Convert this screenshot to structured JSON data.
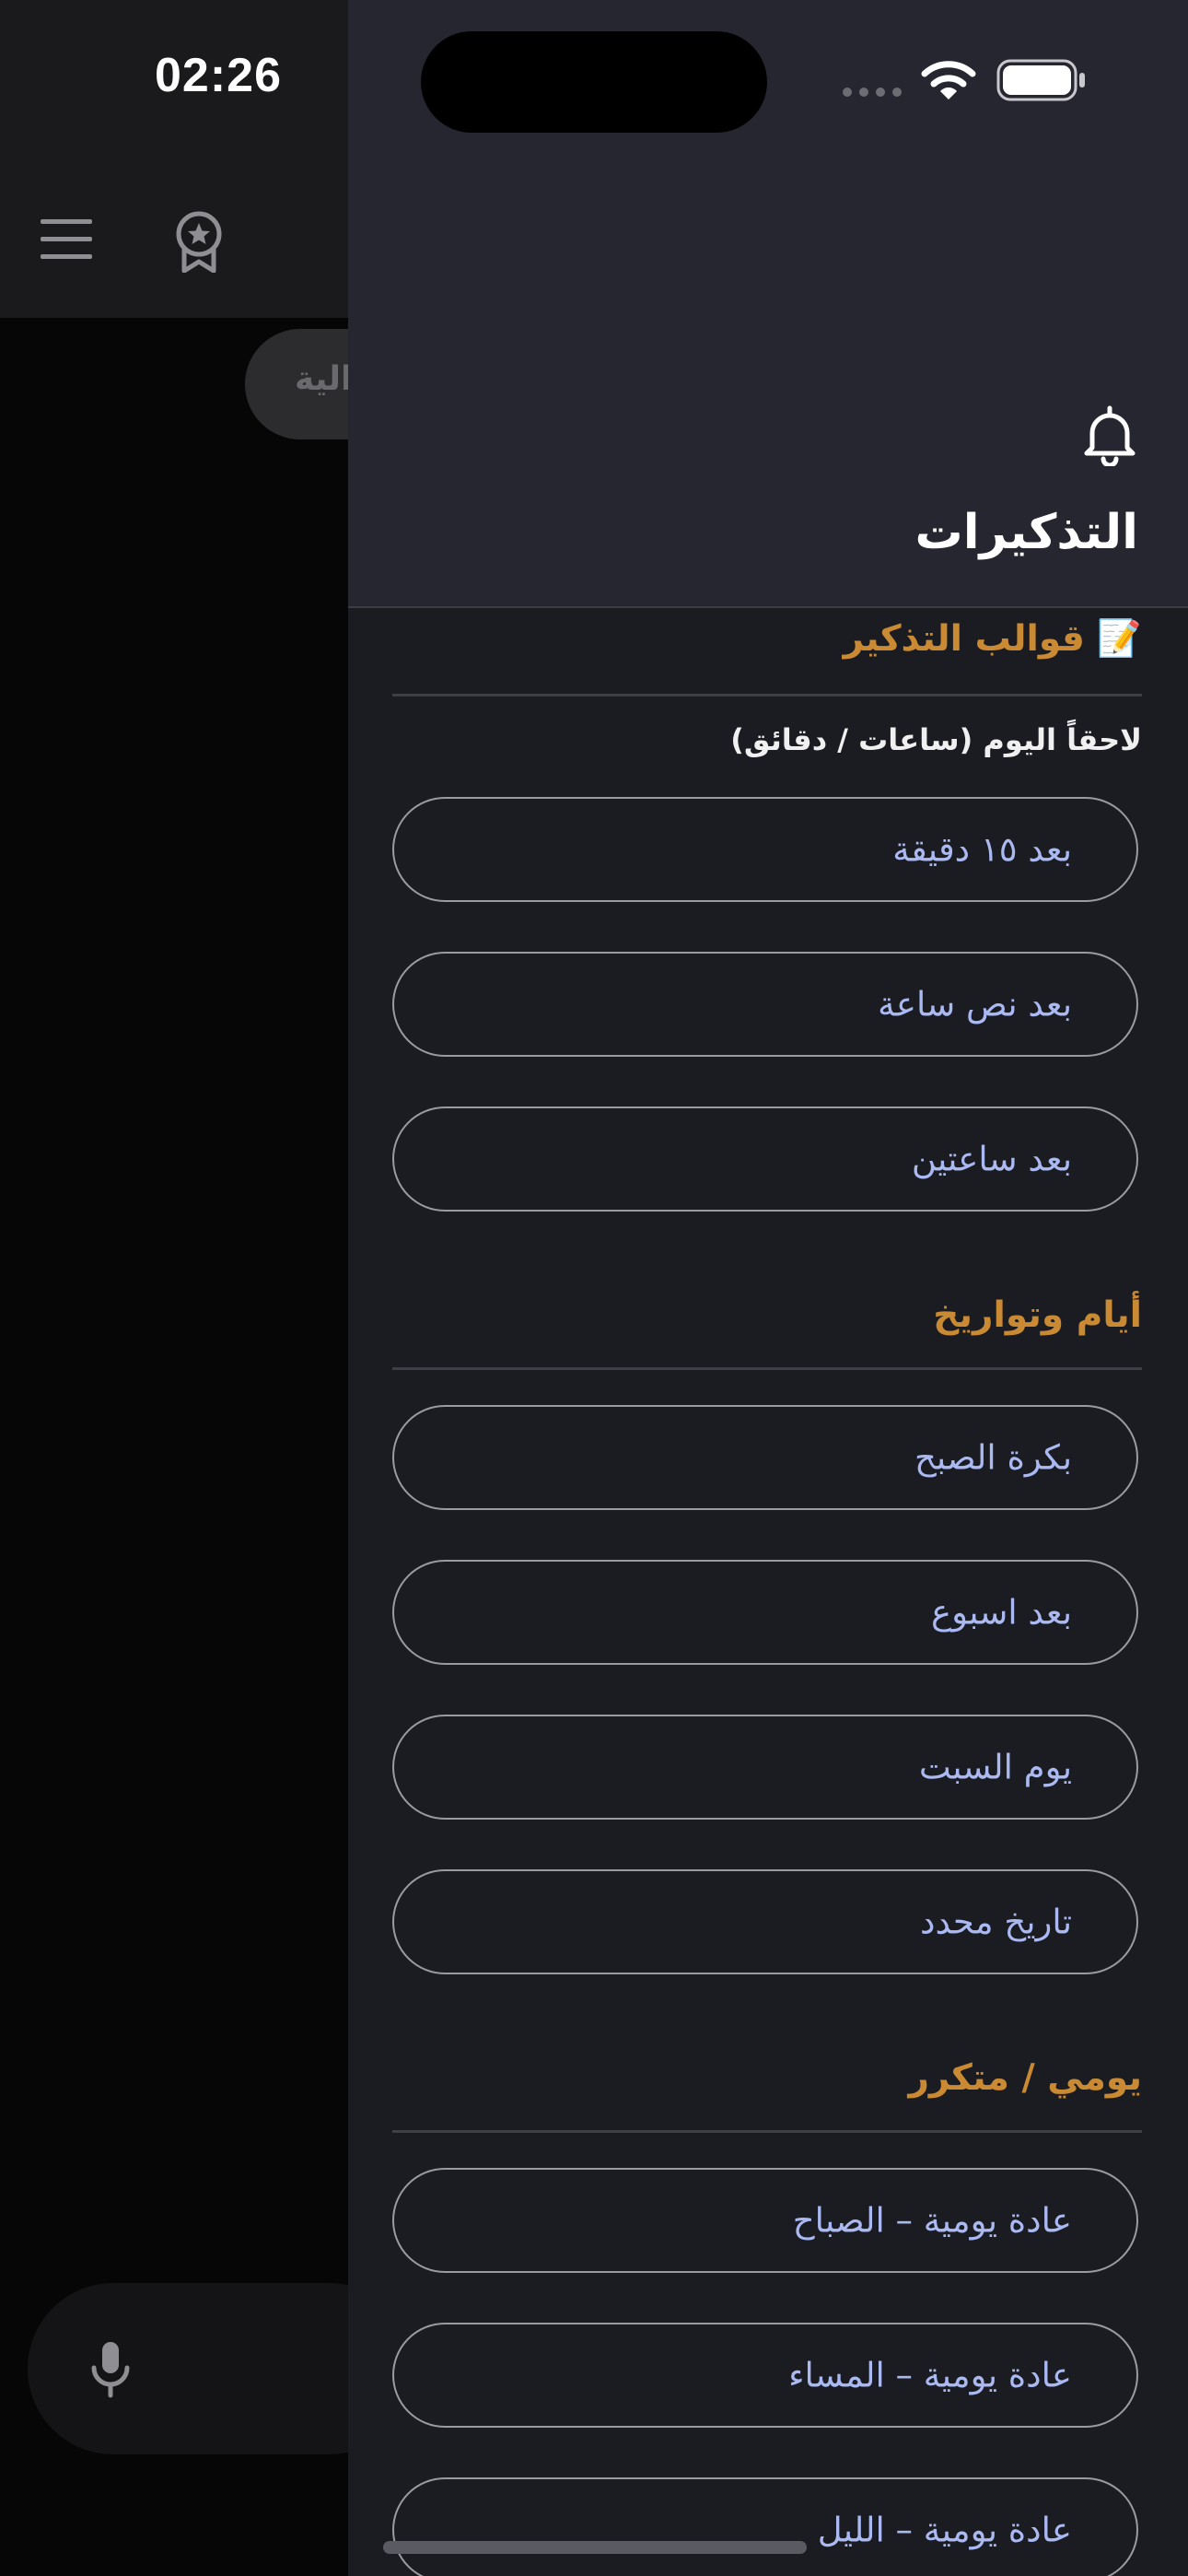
{
  "status_bar": {
    "time": "02:26"
  },
  "background": {
    "menu_icon": "hamburger-menu-icon",
    "badge_icon": "award-badge-icon",
    "chip_text": "الية",
    "mic_icon": "microphone-icon"
  },
  "drawer": {
    "bell_icon": "bell-icon",
    "title": "التذكيرات",
    "templates_heading": "📝 قوالب التذكير",
    "later_today_label": "لاحقاً اليوم (ساعات / دقائق)",
    "later_today_options": [
      "بعد ١٥ دقيقة",
      "بعد نص ساعة",
      "بعد ساعتين"
    ],
    "days_heading": "أيام وتواريخ",
    "days_options": [
      "بكرة الصبح",
      "بعد اسبوع",
      "يوم السبت",
      "تاريخ محدد"
    ],
    "daily_heading": "يومي / متكرر",
    "daily_options": [
      "عادة يومية – الصباح",
      "عادة يومية – المساء",
      "عادة يومية – الليل"
    ]
  },
  "colors": {
    "drawer_bg": "#1b1c21",
    "header_bg": "#25262f",
    "section_heading": "#c98a33",
    "option_text": "#aab9f2",
    "option_border": "#9a9aa2"
  }
}
